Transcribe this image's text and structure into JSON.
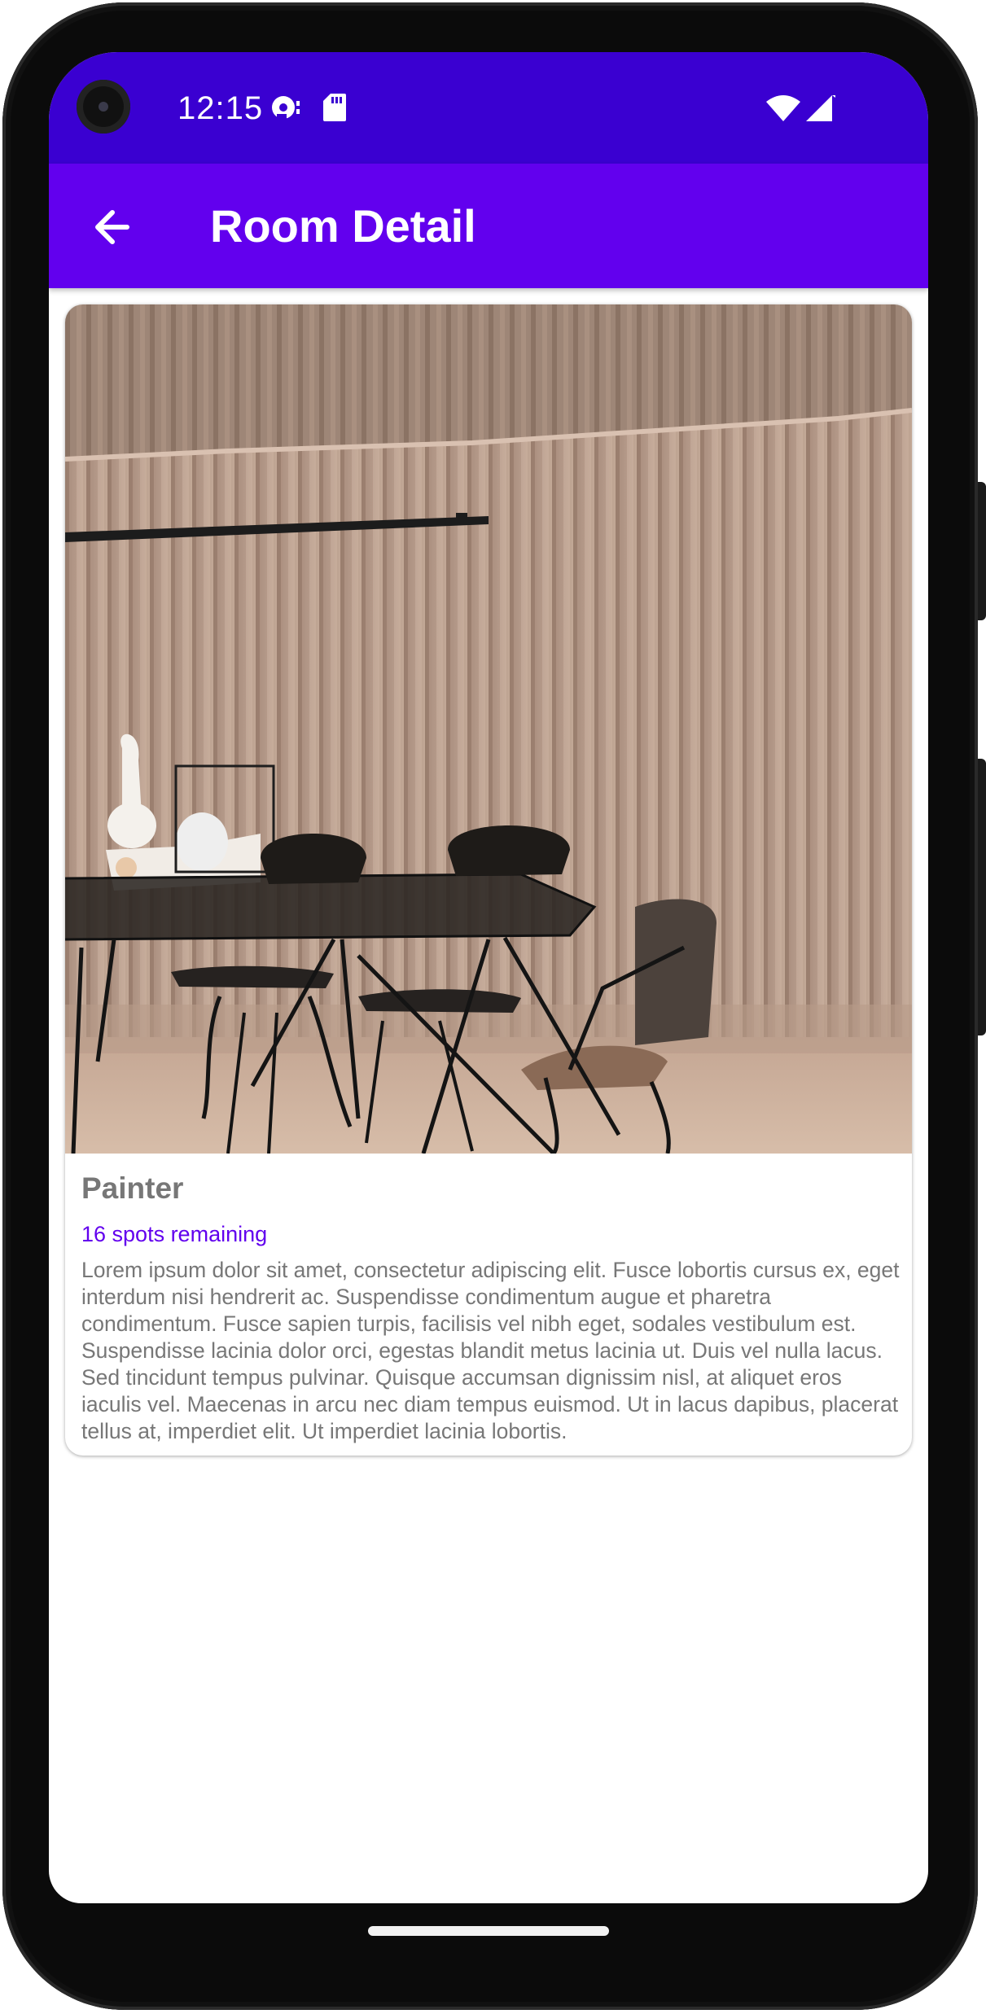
{
  "status_bar": {
    "time": "12:15",
    "icons": [
      "camera-icon",
      "sync-debug-icon",
      "sd-card-icon",
      "wifi-icon",
      "cell-signal-icon"
    ]
  },
  "app_bar": {
    "title": "Room Detail",
    "back_icon": "arrow-back-icon"
  },
  "room": {
    "name": "Painter",
    "spots": "16 spots remaining",
    "description": "Lorem ipsum dolor sit amet, consectetur adipiscing elit. Fusce lobortis cursus ex, eget interdum nisi hendrerit ac. Suspendisse condimentum augue et pharetra condimentum. Fusce sapien turpis, facilisis vel nibh eget, sodales vestibulum est. Suspendisse lacinia dolor orci, egestas blandit metus lacinia ut. Duis vel nulla lacus. Sed tincidunt tempus pulvinar. Quisque accumsan dignissim nisl, at aliquet eros iaculis vel. Maecenas in arcu nec diam tempus euismod. Ut in lacus dapibus, placerat tellus at, imperdiet elit. Ut imperdiet lacinia lobortis."
  },
  "colors": {
    "status_bar": "#3a00d1",
    "app_bar": "#6200ee",
    "accent": "#6200ee",
    "text_secondary": "#777777"
  }
}
